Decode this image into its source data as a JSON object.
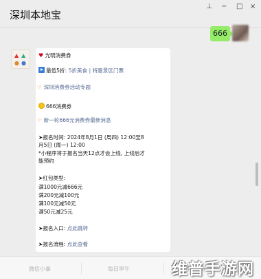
{
  "header": {
    "title": "深圳本地宝",
    "pin_icon": "pin-icon",
    "controls": [
      "−",
      "□",
      "×"
    ]
  },
  "me": {
    "message": "666"
  },
  "card": {
    "line1": "光明消费券",
    "line2_prefix": "最低5折: ",
    "line2_link": "5折美食 | 特惠景区门票",
    "line3_link": "深圳消费券活动专题",
    "line4": "666消费券",
    "line5_link": "新一轮666元消费券最新消息",
    "signup_time_1": "➤报名时间: 2024年8月1日 (周四) 12:00至8",
    "signup_time_2": "月5日 (周一) 12:00",
    "note_1": "*小程序将于报名当天12点才会上线, 上线后才",
    "note_2": "能预约",
    "types_header": "➤红包类型:",
    "types": [
      "满1000元减666元",
      "满200元减100元",
      "满100元减50元",
      "满50元减25元"
    ],
    "entry_label": "➤报名入口: ",
    "entry_link": "点此跳转",
    "process_label": "➤报名流程: ",
    "process_link": "点此查看"
  },
  "bottom_menu": [
    "微信小事",
    "每日早午",
    "消费券汇总"
  ],
  "watermark": "维普手游网"
}
